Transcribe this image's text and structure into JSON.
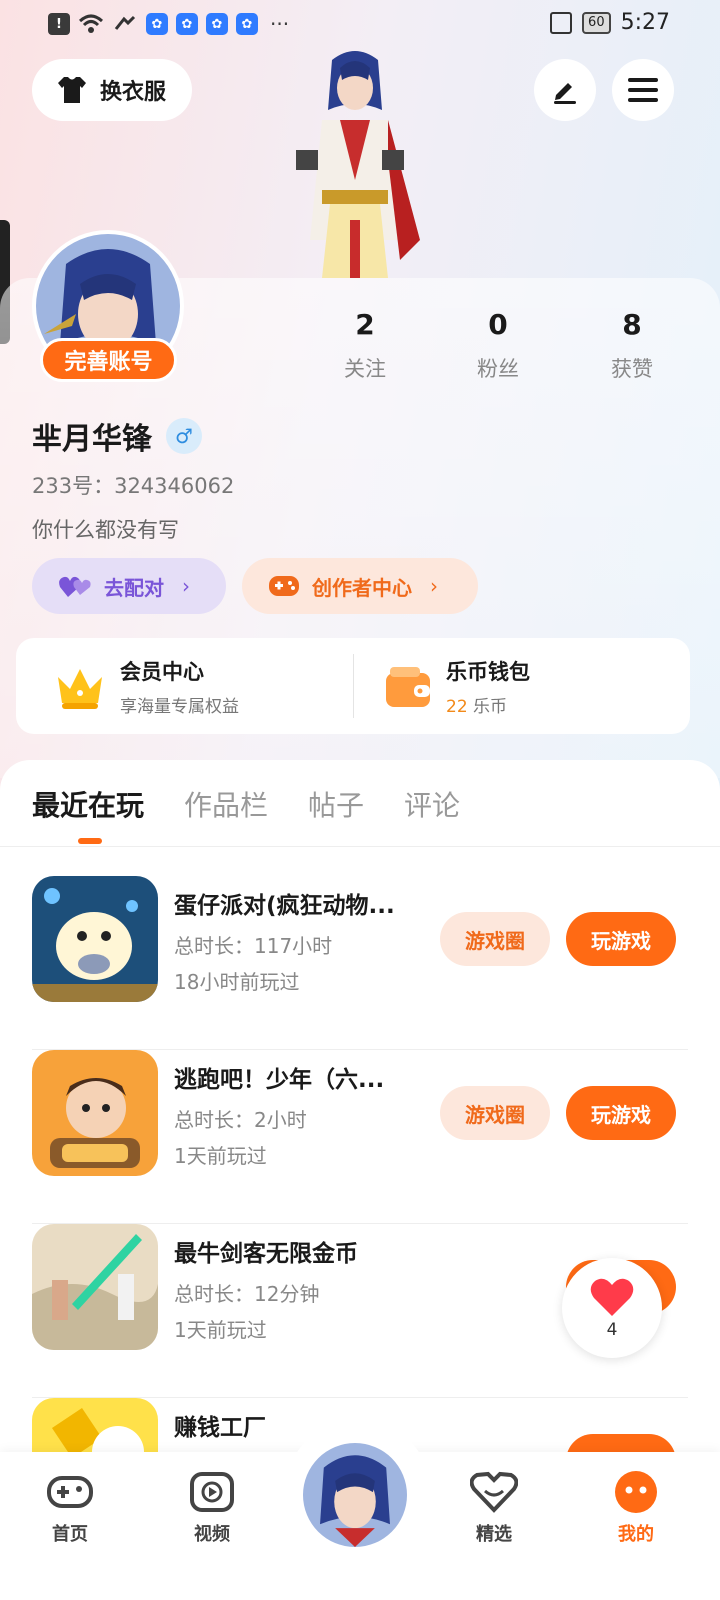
{
  "status_bar": {
    "time": "5:27",
    "battery": "60",
    "dots": "···"
  },
  "header": {
    "outfit_label": "换衣服"
  },
  "profile": {
    "complete_badge": "完善账号",
    "stats": [
      {
        "value": "2",
        "label": "关注"
      },
      {
        "value": "0",
        "label": "粉丝"
      },
      {
        "value": "8",
        "label": "获赞"
      }
    ],
    "username": "芈月华锋",
    "gender_symbol": "♂",
    "uid": "233号：324346062",
    "bio": "你什么都没有写",
    "pills": {
      "match_label": "去配对",
      "creator_label": "创作者中心",
      "chevron": "›"
    }
  },
  "cards": {
    "vip": {
      "title": "会员中心",
      "subtitle": "享海量专属权益"
    },
    "wallet": {
      "title": "乐币钱包",
      "amount": "22",
      "unit": "乐币"
    }
  },
  "tabs": [
    {
      "label": "最近在玩",
      "active": true
    },
    {
      "label": "作品栏",
      "active": false
    },
    {
      "label": "帖子",
      "active": false
    },
    {
      "label": "评论",
      "active": false
    }
  ],
  "games": [
    {
      "name": "蛋仔派对(疯狂动物...",
      "time": "总时长：117小时",
      "last": "18小时前玩过",
      "circle_label": "游戏圈",
      "play_label": "玩游戏"
    },
    {
      "name": "逃跑吧！少年（六...",
      "time": "总时长：2小时",
      "last": "1天前玩过",
      "circle_label": "游戏圈",
      "play_label": "玩游戏"
    },
    {
      "name": "最牛剑客无限金币",
      "time": "总时长：12分钟",
      "last": "1天前玩过",
      "circle_label": "",
      "play_label": ""
    },
    {
      "name": "赚钱工厂",
      "time": "",
      "last": "",
      "circle_label": "",
      "play_label": ""
    }
  ],
  "like_float": {
    "count": "4"
  },
  "bottom_nav": {
    "home": "首页",
    "video": "视频",
    "featured": "精选",
    "mine": "我的"
  },
  "colors": {
    "accent": "#ff6a14",
    "purple": "#7a55d8",
    "blue": "#2e8de0"
  }
}
